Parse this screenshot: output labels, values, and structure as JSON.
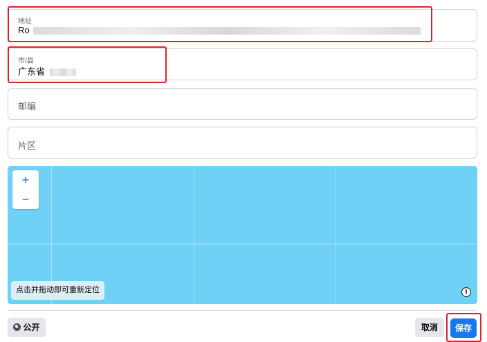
{
  "address": {
    "label": "地址",
    "value_visible_prefix": "Ro"
  },
  "city": {
    "label": "市/县",
    "value_visible_prefix": "广东省"
  },
  "postal": {
    "placeholder": "邮编"
  },
  "district": {
    "placeholder": "片区"
  },
  "map": {
    "zoom_in": "+",
    "zoom_out": "−",
    "hint": "点击并拖动即可重新定位",
    "info_glyph": "i",
    "water_color": "#6fd1f5"
  },
  "footer": {
    "privacy_label": "公开",
    "privacy_icon": "globe-icon",
    "cancel_label": "取消",
    "save_label": "保存"
  },
  "colors": {
    "accent": "#1877f2",
    "highlight": "#e0212a"
  }
}
